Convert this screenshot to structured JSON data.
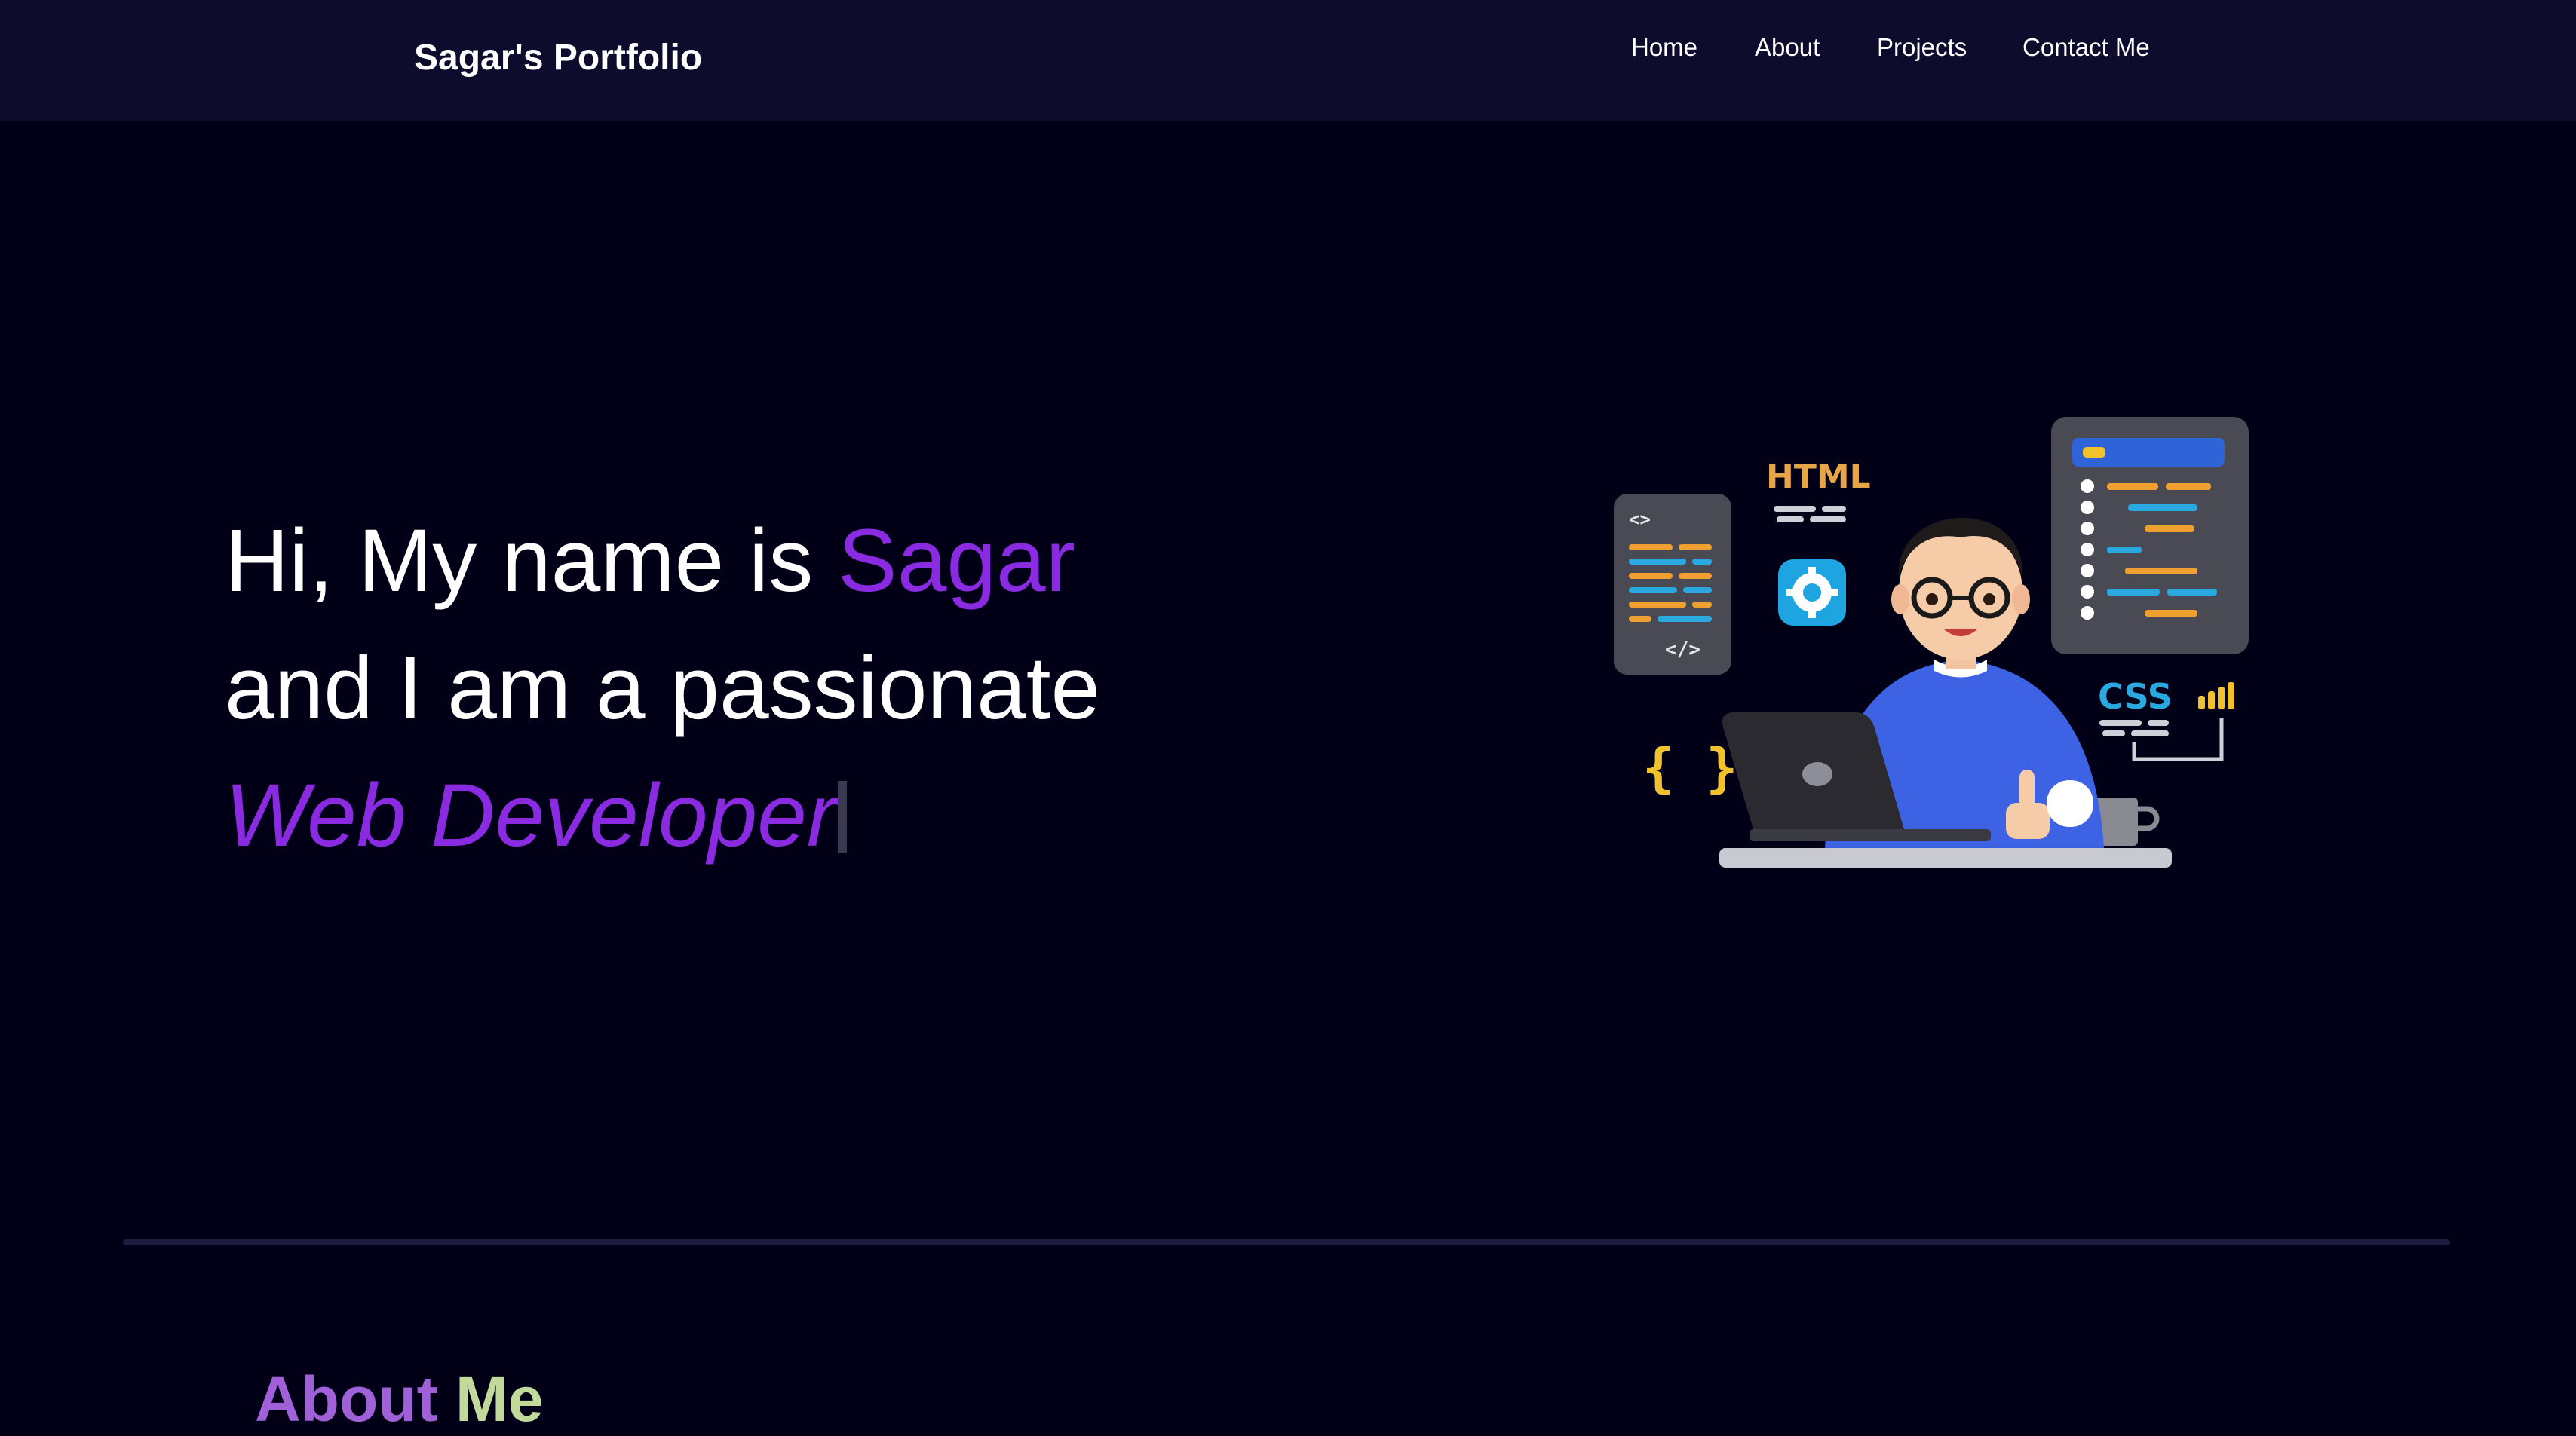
{
  "navbar": {
    "brand": "Sagar's Portfolio",
    "links": [
      "Home",
      "About",
      "Projects",
      "Contact Me"
    ]
  },
  "hero": {
    "line1_prefix": "Hi, My name is ",
    "line1_name": "Sagar",
    "line2": "and I am a passionate",
    "typed_text": "Web Developer"
  },
  "illustration": {
    "html_label": "HTML",
    "css_label": "CSS",
    "code_open_tag": "<>",
    "code_close_tag": "</>",
    "braces": "{ }"
  },
  "about": {
    "title_part1": "About ",
    "title_part2": "Me"
  },
  "colors": {
    "page_background": "#010016",
    "navbar_background": "#0d0c2d",
    "accent_purple": "#8a2be2",
    "about_me_green": "#c1d99a",
    "divider": "#1f1d3f"
  },
  "icons": [
    "gear-icon",
    "laptop-icon",
    "coffee-mug-icon",
    "thumbs-up-icon",
    "bar-chart-icon",
    "code-panel-icon",
    "developer-avatar-icon"
  ]
}
